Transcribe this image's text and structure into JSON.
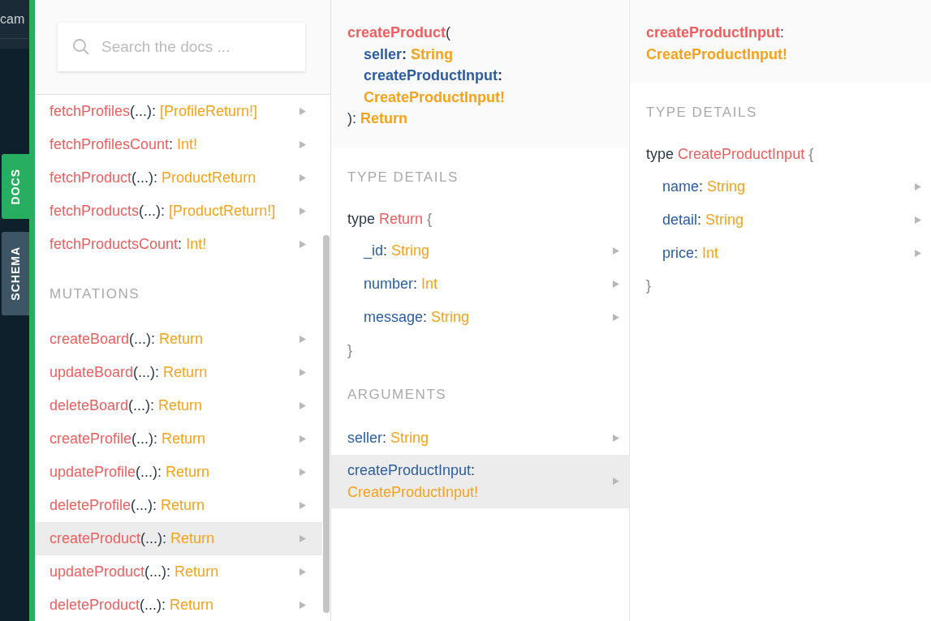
{
  "side_strip": {
    "text": "cam"
  },
  "tabs": [
    {
      "label": "DOCS",
      "selected": true
    },
    {
      "label": "SCHEMA",
      "selected": false
    }
  ],
  "search": {
    "placeholder": "Search the docs ..."
  },
  "sections": [
    {
      "items": [
        {
          "name": "fetchProfiles",
          "punct": "(...):",
          "type": "[ProfileReturn!]",
          "selected": false
        },
        {
          "name": "fetchProfilesCount",
          "punct": ":",
          "type": "Int!",
          "selected": false
        },
        {
          "name": "fetchProduct",
          "punct": "(...):",
          "type": "ProductReturn",
          "selected": false
        },
        {
          "name": "fetchProducts",
          "punct": "(...):",
          "type": "[ProductReturn!]",
          "selected": false
        },
        {
          "name": "fetchProductsCount",
          "punct": ":",
          "type": "Int!",
          "selected": false
        }
      ]
    },
    {
      "title": "MUTATIONS",
      "items": [
        {
          "name": "createBoard",
          "punct": "(...):",
          "type": "Return",
          "selected": false
        },
        {
          "name": "updateBoard",
          "punct": "(...):",
          "type": "Return",
          "selected": false
        },
        {
          "name": "deleteBoard",
          "punct": "(...):",
          "type": "Return",
          "selected": false
        },
        {
          "name": "createProfile",
          "punct": "(...):",
          "type": "Return",
          "selected": false
        },
        {
          "name": "updateProfile",
          "punct": "(...):",
          "type": "Return",
          "selected": false
        },
        {
          "name": "deleteProfile",
          "punct": "(...):",
          "type": "Return",
          "selected": false
        },
        {
          "name": "createProduct",
          "punct": "(...):",
          "type": "Return",
          "selected": true
        },
        {
          "name": "updateProduct",
          "punct": "(...):",
          "type": "Return",
          "selected": false
        },
        {
          "name": "deleteProduct",
          "punct": "(...):",
          "type": "Return",
          "selected": false
        }
      ]
    }
  ],
  "panels": [
    {
      "header": {
        "name": "createProduct",
        "open": "(",
        "args": [
          {
            "name": "seller",
            "punct": ":",
            "type": "String"
          },
          {
            "name": "createProductInput",
            "punct": ":",
            "type": "CreateProductInput!"
          }
        ],
        "close": "):",
        "type": "Return"
      },
      "type_details": {
        "title": "TYPE DETAILS",
        "keyword": "type",
        "name": "Return",
        "open": "{",
        "fields": [
          {
            "name": "_id",
            "punct": ":",
            "type": "String"
          },
          {
            "name": "number",
            "punct": ":",
            "type": "Int"
          },
          {
            "name": "message",
            "punct": ":",
            "type": "String"
          }
        ],
        "close": "}"
      },
      "arguments": {
        "title": "ARGUMENTS",
        "items": [
          {
            "name": "seller",
            "punct": ":",
            "type": "String",
            "selected": false
          },
          {
            "name": "createProductInput",
            "punct": ":",
            "type": "CreateProductInput!",
            "selected": true
          }
        ]
      }
    },
    {
      "header": {
        "name": "createProductInput",
        "close": ":",
        "type": "CreateProductInput!"
      },
      "type_details": {
        "title": "TYPE DETAILS",
        "keyword": "type",
        "name": "CreateProductInput",
        "open": "{",
        "fields": [
          {
            "name": "name",
            "punct": ":",
            "type": "String"
          },
          {
            "name": "detail",
            "punct": ":",
            "type": "String"
          },
          {
            "name": "price",
            "punct": ":",
            "type": "Int"
          }
        ],
        "close": "}"
      }
    }
  ]
}
